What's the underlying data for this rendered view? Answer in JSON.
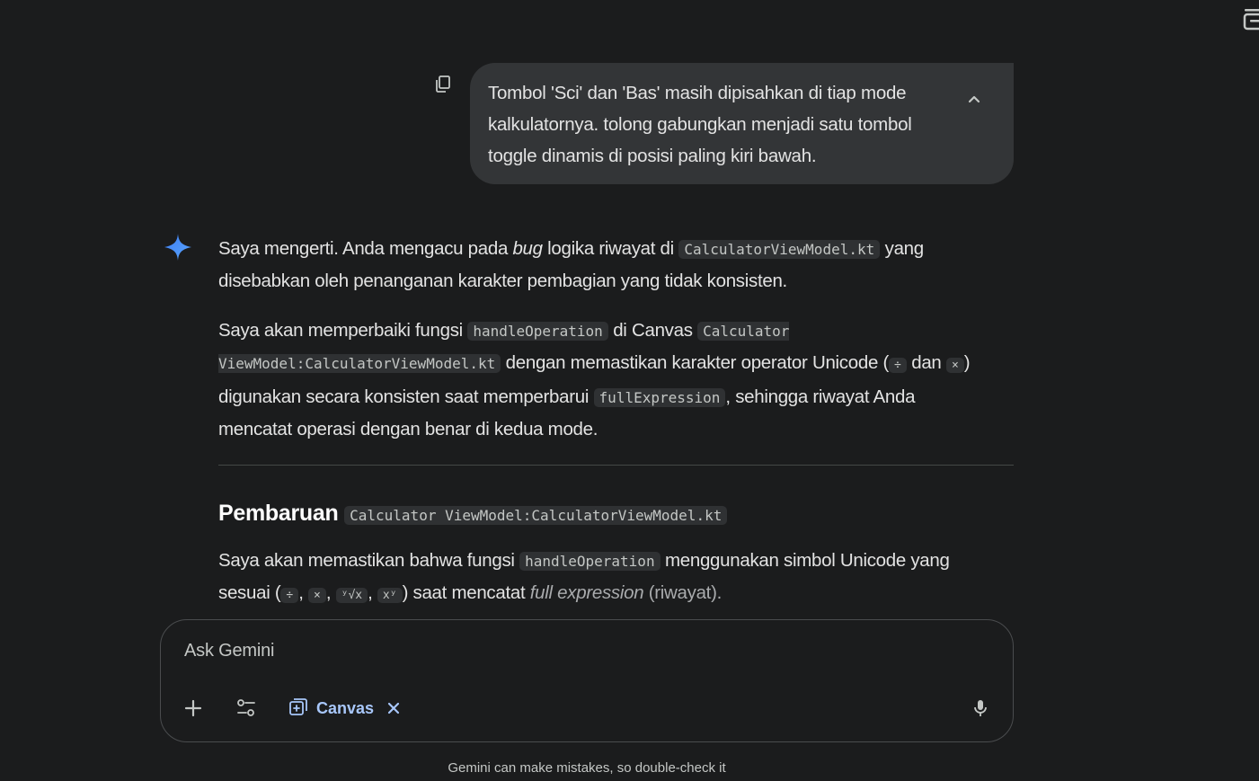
{
  "user_message": {
    "text": "Tombol 'Sci' dan 'Bas' masih dipisahkan di tiap mode kalkulatornya. tolong gabungkan menjadi satu tombol toggle dinamis di posisi paling kiri bawah."
  },
  "response": {
    "p1": {
      "t1": "Saya mengerti. Anda mengacu pada ",
      "em1": "bug",
      "t2": " logika riwayat di ",
      "code1": "CalculatorViewModel.kt",
      "t3": " yang disebabkan oleh penanganan karakter pembagian yang tidak konsisten."
    },
    "p2": {
      "t1": "Saya akan memperbaiki fungsi ",
      "code1": "handleOperation",
      "t2": " di Canvas ",
      "code2": "Calculator ViewModel:CalculatorViewModel.kt",
      "t3": " dengan memastikan karakter operator Unicode (",
      "code3": "÷",
      "t4": " dan ",
      "code4": "×",
      "t5": ") digunakan secara konsisten saat memperbarui ",
      "code5": "fullExpression",
      "t6": ", sehingga riwayat Anda mencatat operasi dengan benar di kedua mode."
    },
    "heading": {
      "text": "Pembaruan",
      "code": "Calculator ViewModel:CalculatorViewModel.kt"
    },
    "p3": {
      "t1": "Saya akan memastikan bahwa fungsi ",
      "code1": "handleOperation",
      "t2": " menggunakan simbol Unicode yang sesuai (",
      "code2": "÷",
      "sep1": ", ",
      "code3": "×",
      "sep2": ", ",
      "code4": "ʸ√x",
      "sep3": ", ",
      "code5": "xʸ",
      "t3": ") saat mencatat ",
      "em1": "full expression",
      "t4": " (riwayat)."
    }
  },
  "input": {
    "placeholder": "Ask Gemini",
    "canvas_label": "Canvas"
  },
  "disclaimer": "Gemini can make mistakes, so double-check it",
  "icons": {
    "copy": "copy-icon",
    "collapse": "chevron-up-icon",
    "sparkle": "gemini-sparkle-icon",
    "plus": "plus-icon",
    "tools": "tools-icon",
    "canvas": "canvas-icon",
    "close": "close-icon",
    "mic": "mic-icon"
  },
  "colors": {
    "background": "#1b1c1d",
    "bubble": "#333537",
    "accent": "#a8c7fa",
    "sparkle": "#4a90f7"
  }
}
